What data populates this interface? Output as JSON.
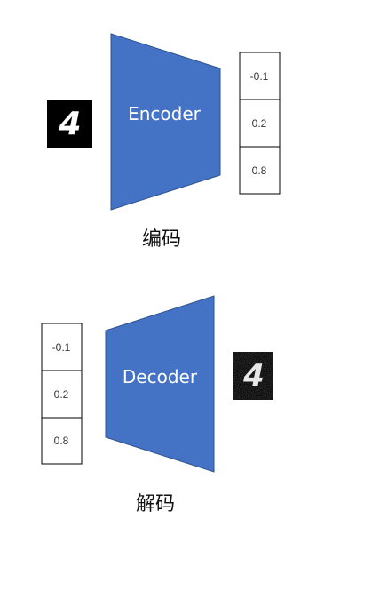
{
  "encoder": {
    "label": "Encoder",
    "caption": "编码",
    "vector": [
      "-0.1",
      "0.2",
      "0.8"
    ]
  },
  "decoder": {
    "label": "Decoder",
    "caption": "解码",
    "vector": [
      "-0.1",
      "0.2",
      "0.8"
    ]
  },
  "input_image": {
    "glyph": "4"
  },
  "output_image": {
    "glyph": "4"
  },
  "colors": {
    "block_fill": "#4472c4",
    "block_stroke": "#2f528f",
    "cell_border": "#000000",
    "image_bg": "#000000"
  }
}
